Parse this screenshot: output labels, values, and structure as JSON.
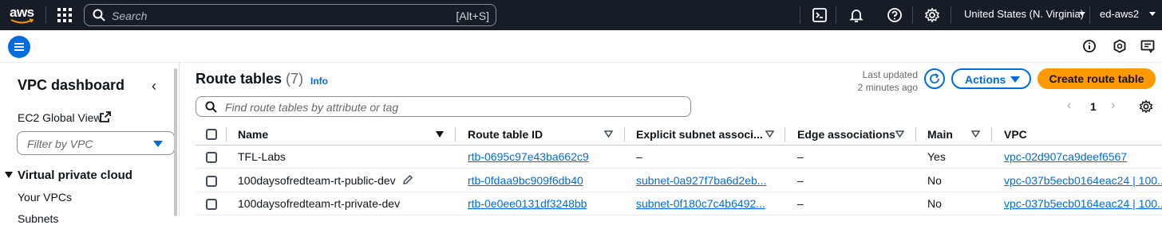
{
  "topnav": {
    "logo_text": "aws",
    "search_placeholder": "Search",
    "search_shortcut": "[Alt+S]",
    "region": "United States (N. Virginia)",
    "account": "ed-aws2"
  },
  "sidebar": {
    "title": "VPC dashboard",
    "global_view": "EC2 Global View",
    "filter_placeholder": "Filter by VPC",
    "section": "Virtual private cloud",
    "items": [
      "Your VPCs",
      "Subnets"
    ]
  },
  "main": {
    "title": "Route tables",
    "count": "(7)",
    "info": "Info",
    "last_updated_line1": "Last updated",
    "last_updated_line2": "2 minutes ago",
    "actions_label": "Actions",
    "create_label": "Create route table",
    "filter_placeholder": "Find route tables by attribute or tag",
    "page": "1"
  },
  "table": {
    "columns": [
      "Name",
      "Route table ID",
      "Explicit subnet associ...",
      "Edge associations",
      "Main",
      "VPC"
    ],
    "rows": [
      {
        "name": "TFL-Labs",
        "id": "rtb-0695c97e43ba662c9",
        "subnet": "–",
        "edge": "–",
        "main": "Yes",
        "vpc": "vpc-02d907ca9deef6567"
      },
      {
        "name": "100daysofredteam-rt-public-dev",
        "id": "rtb-0fdaa9bc909f6db40",
        "subnet": "subnet-0a927f7ba6d2eb...",
        "edge": "–",
        "main": "No",
        "vpc": "vpc-037b5ecb0164eac24 | 100..."
      },
      {
        "name": "100daysofredteam-rt-private-dev",
        "id": "rtb-0e0ee0131df3248bb",
        "subnet": "subnet-0f180c7c4b6492...",
        "edge": "–",
        "main": "No",
        "vpc": "vpc-037b5ecb0164eac24 | 100..."
      }
    ]
  },
  "colors": {
    "nav_bg": "#161d26",
    "link": "#006ce0",
    "primary_button": "#ff9900"
  }
}
